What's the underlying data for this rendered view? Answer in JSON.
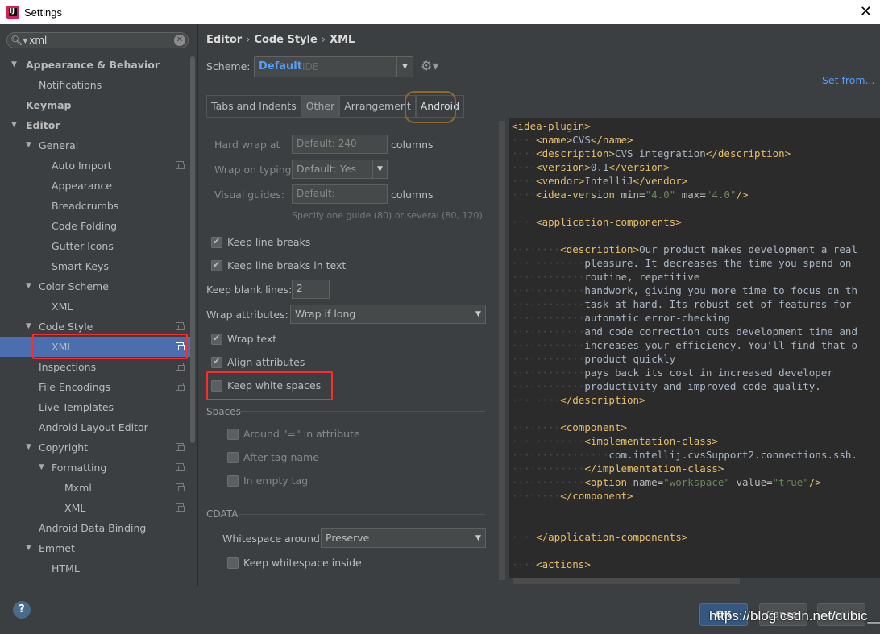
{
  "window": {
    "title": "Settings"
  },
  "search": {
    "value": "xml"
  },
  "tree": [
    {
      "label": "Appearance & Behavior",
      "depth": 0,
      "arrow": "▼",
      "bold": true,
      "copy": false,
      "selected": false
    },
    {
      "label": "Notifications",
      "depth": 1,
      "arrow": "",
      "bold": false,
      "copy": false,
      "selected": false
    },
    {
      "label": "Keymap",
      "depth": 0,
      "arrow": "",
      "bold": true,
      "copy": false,
      "selected": false
    },
    {
      "label": "Editor",
      "depth": 0,
      "arrow": "▼",
      "bold": true,
      "copy": false,
      "selected": false
    },
    {
      "label": "General",
      "depth": 1,
      "arrow": "▼",
      "bold": false,
      "copy": false,
      "selected": false
    },
    {
      "label": "Auto Import",
      "depth": 2,
      "arrow": "",
      "bold": false,
      "copy": true,
      "selected": false
    },
    {
      "label": "Appearance",
      "depth": 2,
      "arrow": "",
      "bold": false,
      "copy": false,
      "selected": false
    },
    {
      "label": "Breadcrumbs",
      "depth": 2,
      "arrow": "",
      "bold": false,
      "copy": false,
      "selected": false
    },
    {
      "label": "Code Folding",
      "depth": 2,
      "arrow": "",
      "bold": false,
      "copy": false,
      "selected": false
    },
    {
      "label": "Gutter Icons",
      "depth": 2,
      "arrow": "",
      "bold": false,
      "copy": false,
      "selected": false
    },
    {
      "label": "Smart Keys",
      "depth": 2,
      "arrow": "",
      "bold": false,
      "copy": false,
      "selected": false
    },
    {
      "label": "Color Scheme",
      "depth": 1,
      "arrow": "▼",
      "bold": false,
      "copy": false,
      "selected": false
    },
    {
      "label": "XML",
      "depth": 2,
      "arrow": "",
      "bold": false,
      "copy": false,
      "selected": false
    },
    {
      "label": "Code Style",
      "depth": 1,
      "arrow": "▼",
      "bold": false,
      "copy": true,
      "selected": false
    },
    {
      "label": "XML",
      "depth": 2,
      "arrow": "",
      "bold": false,
      "copy": true,
      "selected": true
    },
    {
      "label": "Inspections",
      "depth": 1,
      "arrow": "",
      "bold": false,
      "copy": true,
      "selected": false
    },
    {
      "label": "File Encodings",
      "depth": 1,
      "arrow": "",
      "bold": false,
      "copy": true,
      "selected": false
    },
    {
      "label": "Live Templates",
      "depth": 1,
      "arrow": "",
      "bold": false,
      "copy": false,
      "selected": false
    },
    {
      "label": "Android Layout Editor",
      "depth": 1,
      "arrow": "",
      "bold": false,
      "copy": false,
      "selected": false
    },
    {
      "label": "Copyright",
      "depth": 1,
      "arrow": "▼",
      "bold": false,
      "copy": true,
      "selected": false
    },
    {
      "label": "Formatting",
      "depth": 2,
      "arrow": "▼",
      "bold": false,
      "copy": true,
      "selected": false
    },
    {
      "label": "Mxml",
      "depth": 3,
      "arrow": "",
      "bold": false,
      "copy": true,
      "selected": false
    },
    {
      "label": "XML",
      "depth": 3,
      "arrow": "",
      "bold": false,
      "copy": true,
      "selected": false
    },
    {
      "label": "Android Data Binding",
      "depth": 1,
      "arrow": "",
      "bold": false,
      "copy": false,
      "selected": false
    },
    {
      "label": "Emmet",
      "depth": 1,
      "arrow": "▼",
      "bold": false,
      "copy": false,
      "selected": false
    },
    {
      "label": "HTML",
      "depth": 2,
      "arrow": "",
      "bold": false,
      "copy": false,
      "selected": false
    }
  ],
  "breadcrumb": [
    "Editor",
    "Code Style",
    "XML"
  ],
  "scheme": {
    "label": "Scheme:",
    "value": "Default",
    "suffix": "IDE",
    "set_from": "Set from..."
  },
  "tabs": [
    "Tabs and Indents",
    "Other",
    "Arrangement",
    "Android"
  ],
  "settings": {
    "hard_wrap_label": "Hard wrap at",
    "hard_wrap_placeholder": "Default: 240",
    "columns": "columns",
    "wrap_typing_label": "Wrap on typing",
    "wrap_typing_value": "Default: Yes",
    "visual_guides_label": "Visual guides:",
    "visual_guides_placeholder": "Default:",
    "guides_hint": "Specify one guide (80) or several (80, 120)",
    "keep_line_breaks": "Keep line breaks",
    "keep_line_breaks_text": "Keep line breaks in text",
    "keep_blank_lines_label": "Keep blank lines:",
    "keep_blank_lines_value": "2",
    "wrap_attributes_label": "Wrap attributes:",
    "wrap_attributes_value": "Wrap if long",
    "wrap_text": "Wrap text",
    "align_attributes": "Align attributes",
    "keep_white_spaces": "Keep white spaces",
    "spaces_section": "Spaces",
    "around_eq": "Around \"=\" in attribute",
    "after_tag_name": "After tag name",
    "in_empty_tag": "In empty tag",
    "cdata_section": "CDATA",
    "whitespace_around_label": "Whitespace around:",
    "whitespace_around_value": "Preserve",
    "keep_whitespace_inside": "Keep whitespace inside"
  },
  "buttons": {
    "help": "?",
    "ok": "OK",
    "cancel": "Cancel",
    "apply": "Apply"
  },
  "watermark": "https://blog.csdn.net/cubic__",
  "colors": {
    "selection": "#4b6eaf",
    "link": "#589df6",
    "highlight": "#ff2a2a",
    "tag": "#e8bf6a",
    "attr_value": "#6a8759"
  }
}
